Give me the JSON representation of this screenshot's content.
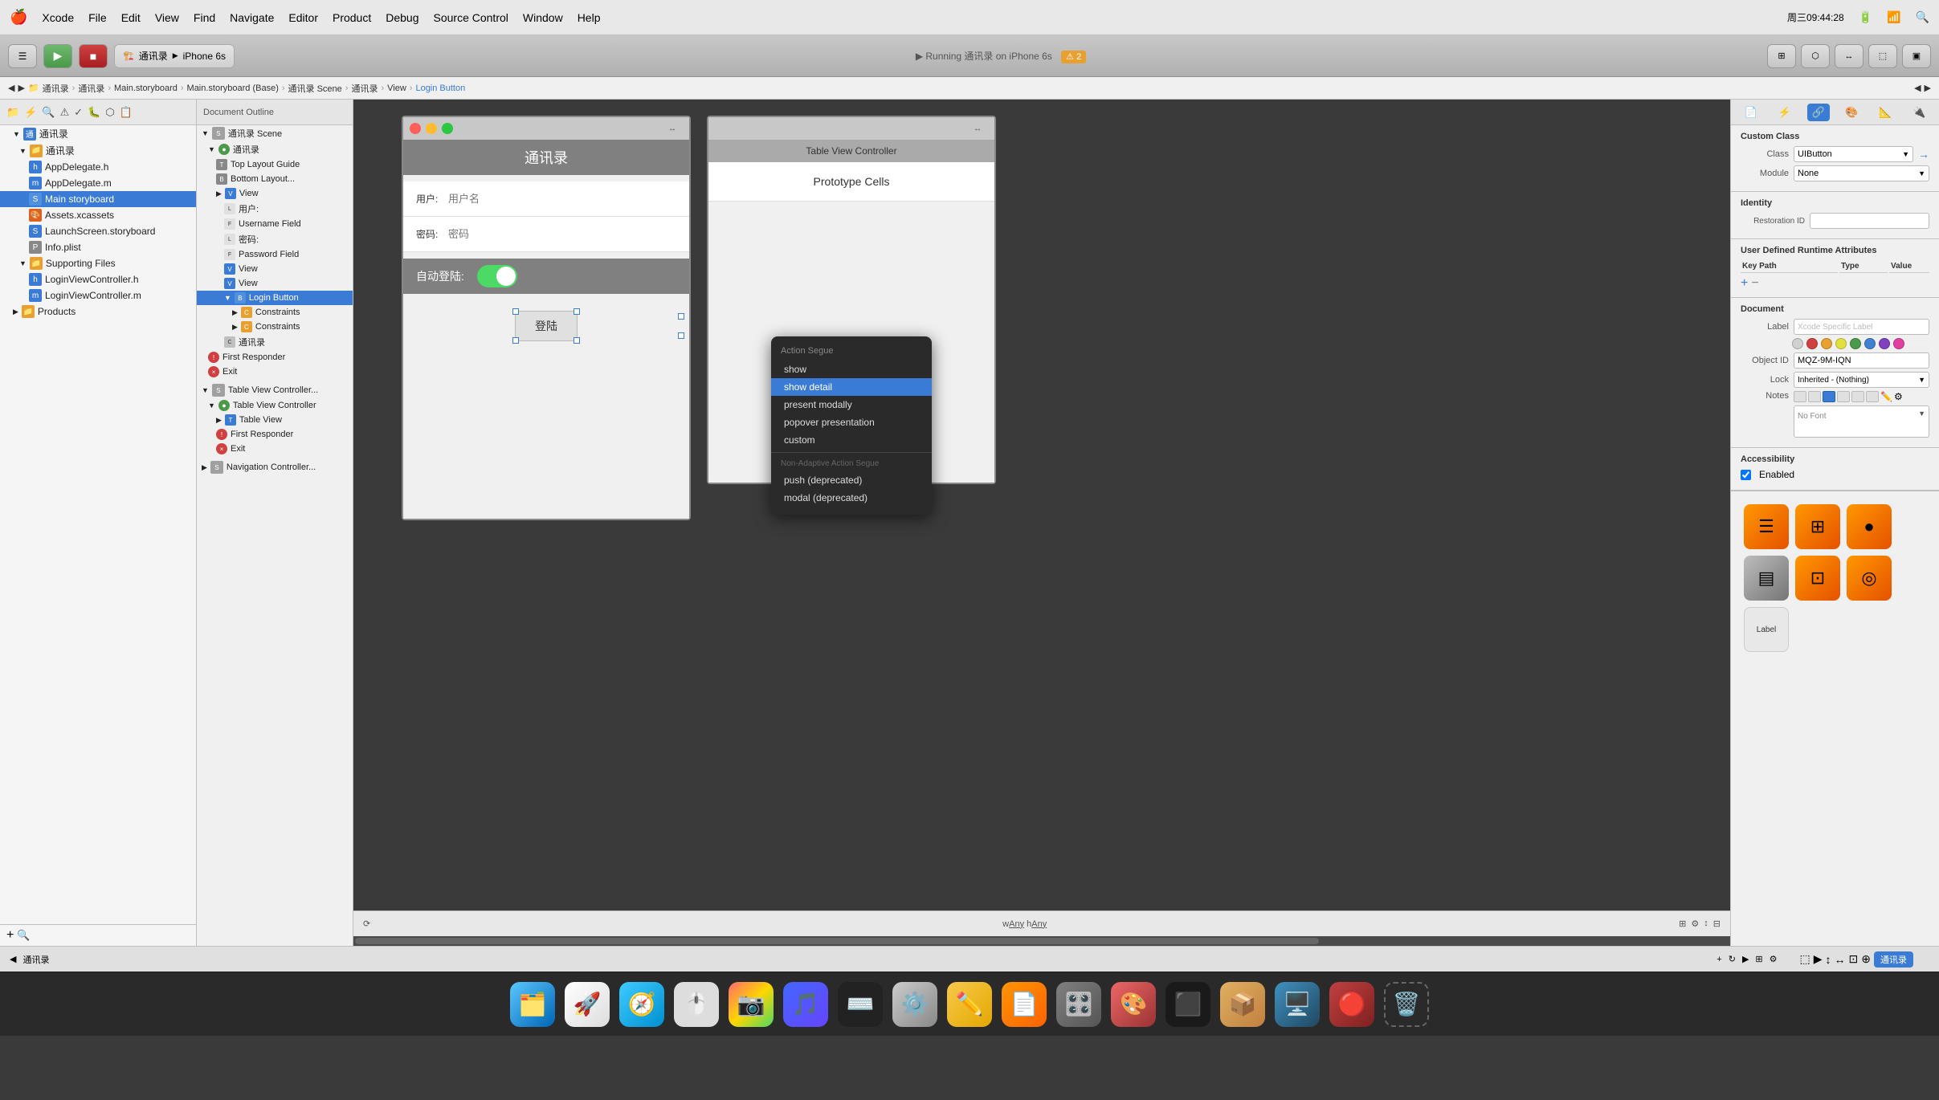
{
  "menubar": {
    "apple": "🍎",
    "items": [
      "Xcode",
      "File",
      "Edit",
      "View",
      "Find",
      "Navigate",
      "Editor",
      "Product",
      "Debug",
      "Source Control",
      "Window",
      "Help"
    ],
    "time": "周三09:44:28",
    "battery": "🔋"
  },
  "toolbar": {
    "run_label": "▶",
    "stop_label": "■",
    "scheme_label": "通讯录",
    "device_label": "iPhone 6s",
    "status": "Running 通讯录 on iPhone 6s",
    "warning_count": "⚠ 2"
  },
  "breadcrumb": {
    "items": [
      "通讯录",
      "通讯录",
      "Main.storyboard",
      "Main.storyboard (Base)",
      "通讯录 Scene",
      "通讯录",
      "View",
      "Login Button"
    ]
  },
  "navigator": {
    "title": "通讯录",
    "items": [
      {
        "label": "通讯录",
        "indent": 0,
        "type": "group"
      },
      {
        "label": "AppDelegate.h",
        "indent": 1,
        "type": "file"
      },
      {
        "label": "AppDelegate.m",
        "indent": 1,
        "type": "file"
      },
      {
        "label": "Main storyboard",
        "indent": 1,
        "type": "storyboard",
        "selected": true
      },
      {
        "label": "Assets.xcassets",
        "indent": 1,
        "type": "assets"
      },
      {
        "label": "LaunchScreen.storyboard",
        "indent": 1,
        "type": "storyboard"
      },
      {
        "label": "Info.plist",
        "indent": 1,
        "type": "plist"
      },
      {
        "label": "Supporting Files",
        "indent": 1,
        "type": "group"
      },
      {
        "label": "LoginViewController.h",
        "indent": 2,
        "type": "file"
      },
      {
        "label": "LoginViewController.m",
        "indent": 2,
        "type": "file"
      },
      {
        "label": "Products",
        "indent": 0,
        "type": "group"
      }
    ]
  },
  "scene_outline": {
    "items": [
      {
        "label": "通讯录 Scene",
        "indent": 0,
        "type": "scene"
      },
      {
        "label": "通讯录",
        "indent": 1,
        "type": "controller"
      },
      {
        "label": "Top Layout Guide",
        "indent": 2,
        "type": "layout"
      },
      {
        "label": "Bottom Layout...",
        "indent": 2,
        "type": "layout"
      },
      {
        "label": "View",
        "indent": 2,
        "type": "view"
      },
      {
        "label": "用户:",
        "indent": 3,
        "type": "label"
      },
      {
        "label": "Username Field",
        "indent": 3,
        "type": "field"
      },
      {
        "label": "密码:",
        "indent": 3,
        "type": "label"
      },
      {
        "label": "Password Field",
        "indent": 3,
        "type": "field"
      },
      {
        "label": "View",
        "indent": 3,
        "type": "view"
      },
      {
        "label": "View",
        "indent": 3,
        "type": "view"
      },
      {
        "label": "Login Button",
        "indent": 3,
        "type": "button",
        "selected": true
      },
      {
        "label": "Constraints",
        "indent": 4,
        "type": "constraints"
      },
      {
        "label": "Constraints",
        "indent": 4,
        "type": "constraints"
      },
      {
        "label": "通讯录",
        "indent": 3,
        "type": "label"
      },
      {
        "label": "First Responder",
        "indent": 1,
        "type": "responder"
      },
      {
        "label": "Exit",
        "indent": 1,
        "type": "exit"
      },
      {
        "label": "Table View Controller...",
        "indent": 0,
        "type": "scene"
      },
      {
        "label": "Table View Controller",
        "indent": 1,
        "type": "controller"
      },
      {
        "label": "Table View",
        "indent": 2,
        "type": "view"
      },
      {
        "label": "First Responder",
        "indent": 2,
        "type": "responder"
      },
      {
        "label": "Exit",
        "indent": 2,
        "type": "exit"
      },
      {
        "label": "Navigation Controller...",
        "indent": 0,
        "type": "scene"
      }
    ]
  },
  "canvas": {
    "login_screen": {
      "title": "通讯录",
      "username_placeholder": "用户名",
      "password_placeholder": "密码",
      "auto_login_label": "自动登陆:",
      "login_button_label": "登陆",
      "toggle_on": true
    },
    "table_view": {
      "title": "Table View Controller",
      "prototype_cells_label": "Prototype Cells"
    }
  },
  "action_segue_popup": {
    "title": "Action Segue",
    "items": [
      "show",
      "show detail",
      "present modally",
      "popover presentation",
      "custom"
    ],
    "section_title": "Non-Adaptive Action Segue",
    "deprecated_items": [
      "push (deprecated)",
      "modal (deprecated)"
    ],
    "highlighted": "show detail"
  },
  "inspector": {
    "title": "Custom Class",
    "class_label": "Class",
    "class_value": "UIButton",
    "module_label": "Module",
    "module_value": "None",
    "identity_section": {
      "title": "Identity",
      "restoration_id_label": "Restoration ID"
    },
    "user_defined_section": {
      "title": "User Defined Runtime Attributes",
      "col_key": "Key Path",
      "col_type": "Type",
      "col_value": "Value"
    },
    "document_section": {
      "title": "Document",
      "label_label": "Label",
      "label_placeholder": "Xcode Specific Label",
      "object_id_label": "Object ID",
      "object_id_value": "MQZ-9M-IQN",
      "lock_label": "Lock",
      "lock_value": "Inherited - (Nothing)",
      "notes_label": "Notes"
    },
    "accessibility_section": {
      "title": "Accessibility",
      "enabled_label": "Enabled",
      "enabled": true
    }
  },
  "bottom_bar": {
    "size_label": "wAny hAny",
    "width": "Any",
    "height": "Any"
  },
  "object_library": {
    "label": "Label"
  },
  "dock": {
    "icons": [
      "🗂️",
      "🚀",
      "🧭",
      "🖱️",
      "📷",
      "🎵",
      "🖥️",
      "🔧",
      "✏️",
      "📄",
      "🗑️"
    ]
  }
}
